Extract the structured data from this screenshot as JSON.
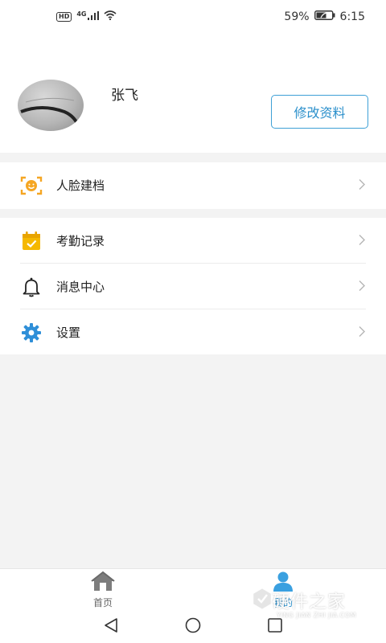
{
  "status_bar": {
    "hd": "HD",
    "network": "4G",
    "battery": "59%",
    "time": "6:15"
  },
  "profile": {
    "name": "张飞",
    "edit_label": "修改资料"
  },
  "menu": {
    "group1": [
      {
        "label": "人脸建档",
        "icon": "face-scan-icon",
        "color": "#f5a623"
      }
    ],
    "group2": [
      {
        "label": "考勤记录",
        "icon": "calendar-check-icon",
        "color": "#f5b800"
      },
      {
        "label": "消息中心",
        "icon": "bell-icon",
        "color": "#222222"
      },
      {
        "label": "设置",
        "icon": "gear-icon",
        "color": "#2f8fd8"
      }
    ]
  },
  "tabs": [
    {
      "label": "首页",
      "icon": "home-icon",
      "active": false
    },
    {
      "label": "我的",
      "icon": "user-icon",
      "active": true
    }
  ],
  "nav": {
    "back": "back-icon",
    "home": "home-circle-icon",
    "recent": "recent-apps-icon"
  },
  "watermark": {
    "text": "硬件之家",
    "sub": "YING JIAN ZHI JIA.COM"
  },
  "colors": {
    "accent": "#2a8fcb",
    "background": "#f3f3f3"
  }
}
